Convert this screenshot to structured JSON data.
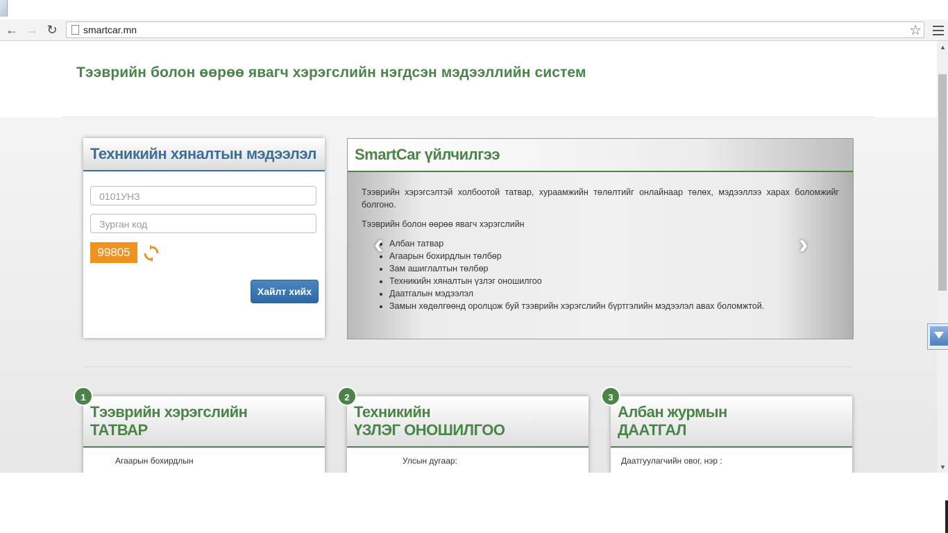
{
  "browser": {
    "url": "smartcar.mn",
    "back_icon": "back-arrow-icon",
    "forward_icon": "forward-arrow-icon",
    "reload_icon": "reload-icon",
    "bookmark_icon": "star-icon",
    "menu_icon": "hamburger-menu-icon"
  },
  "header": {
    "site_title": "Тээврийн болон өөрөө явагч хэрэгслийн нэгдсэн мэдээллийн систем"
  },
  "inspection_panel": {
    "title": "Техникийн хяналтын мэдээлэл",
    "plate_placeholder": "0101УНЗ",
    "code_placeholder": "Зурган код",
    "captcha_value": "99805",
    "search_button": "Хайлт хийх"
  },
  "service_panel": {
    "title": "SmartCar үйлчилгээ",
    "intro": "Тээврийн хэрэгсэлтэй холбоотой татвар, хураамжийн төлөлтийг онлайнаар төлөх, мэдээллээ харах боломжийг болгоно.",
    "lead": "Тээврийн болон өөрөө явагч хэрэгслийн",
    "items": [
      "Албан татвар",
      "Агаарын бохирдлын төлбөр",
      "Зам ашиглалтын төлбөр",
      "Техникийн хяналтын үзлэг оношилгоо",
      "Даатгалын мэдээлэл",
      "Замын хөдөлгөөнд оролцож буй тээврийн хэрэгслийн бүртгэлийн мэдээлэл авах боломжтой."
    ]
  },
  "cards": [
    {
      "badge": "1",
      "title_line1": "Тээврийн хэрэгслийн",
      "title_line2": "ТАТВАР",
      "field_label": "Агаарын бохирдлын"
    },
    {
      "badge": "2",
      "title_line1": "Техникийн",
      "title_line2": "ҮЗЛЭГ ОНОШИЛГОО",
      "field_label": "Улсын дугаар:"
    },
    {
      "badge": "3",
      "title_line1": "Албан журмын",
      "title_line2": "ДААТГАЛ",
      "field_label": "Даатгуулагчийн овог, нэр :"
    }
  ],
  "colors": {
    "brand_green": "#4a8448",
    "panel_blue": "#3e6f9b",
    "captcha_orange": "#f0931e",
    "button_blue": "#2d6aa5"
  }
}
